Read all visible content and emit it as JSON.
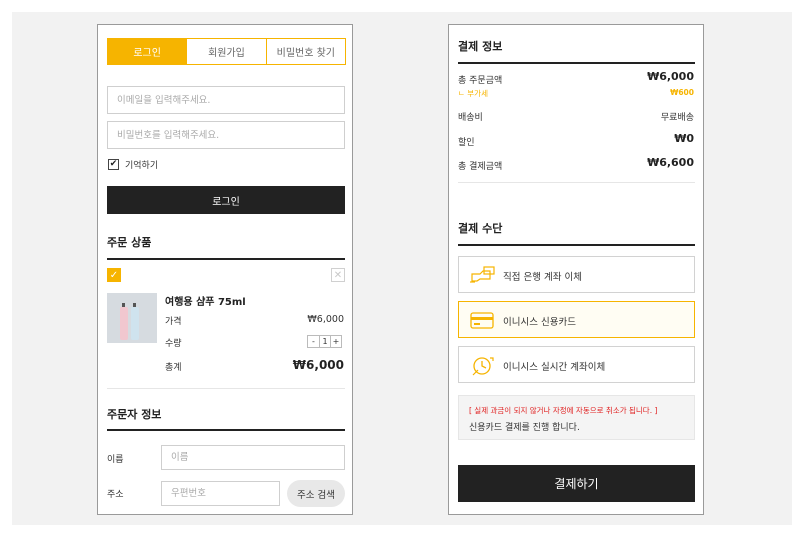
{
  "login": {
    "tabs": [
      {
        "label": "로그인",
        "active": true
      },
      {
        "label": "회원가입",
        "active": false
      },
      {
        "label": "비밀번호 찾기",
        "active": false
      }
    ],
    "email_placeholder": "이메일을 입력해주세요.",
    "password_placeholder": "비밀번호를 입력해주세요.",
    "remember_label": "기억하기",
    "remember_checked": true,
    "submit_label": "로그인"
  },
  "order_products": {
    "title": "주문 상품",
    "item": {
      "checked": true,
      "name": "여행용 샴푸 75ml",
      "price_label": "가격",
      "price": "₩6,000",
      "qty_label": "수량",
      "qty_minus": "-",
      "qty": "1",
      "qty_plus": "+",
      "total_label": "총계",
      "total": "₩6,000"
    }
  },
  "orderer": {
    "title": "주문자 정보",
    "name_label": "이름",
    "name_placeholder": "이름",
    "address_label": "주소",
    "zip_placeholder": "우편번호",
    "address_search_label": "주소 검색"
  },
  "payment_info": {
    "title": "결제 정보",
    "subtotal_label": "총 주문금액",
    "subtotal": "₩6,000",
    "vat_label": "ㄴ 부가세",
    "vat": "₩600",
    "shipping_label": "배송비",
    "shipping": "무료배송",
    "discount_label": "할인",
    "discount": "₩0",
    "total_label": "총 결제금액",
    "total": "₩6,600"
  },
  "payment_method": {
    "title": "결제 수단",
    "options": [
      {
        "label": "직접 은행 계좌 이체",
        "icon": "bank-transfer-icon",
        "selected": false
      },
      {
        "label": "이니시스 신용카드",
        "icon": "credit-card-icon",
        "selected": true
      },
      {
        "label": "이니시스 실시간 계좌이체",
        "icon": "realtime-transfer-icon",
        "selected": false
      }
    ],
    "notice_warning": "[ 실제 과금이 되지 않거나 자정에 자동으로 취소가 됩니다. ]",
    "notice_text": "신용카드 결제를 진행 합니다.",
    "pay_button": "결제하기"
  },
  "colors": {
    "accent": "#f6b400",
    "dark": "#222222",
    "warning": "#e02020",
    "panel_border": "#9a9a9a",
    "background": "#f2f2f2"
  }
}
